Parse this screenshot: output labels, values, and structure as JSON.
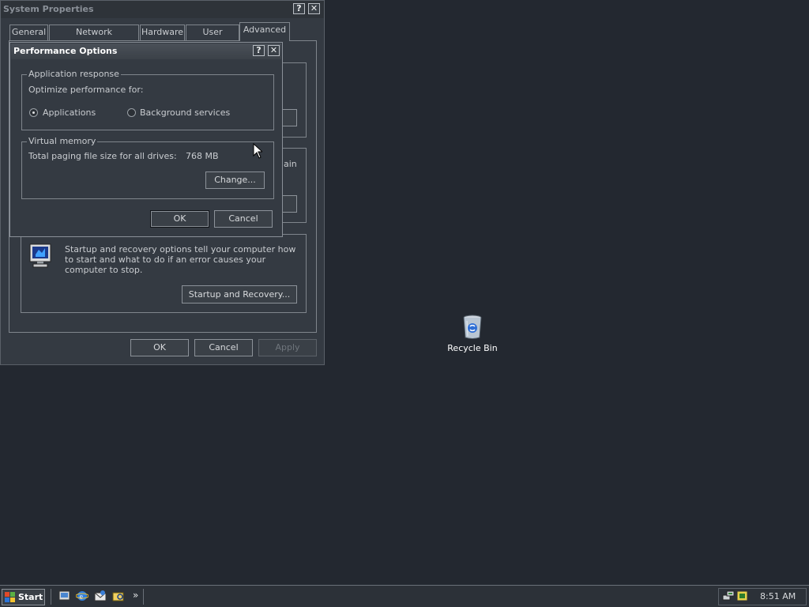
{
  "system_properties": {
    "title": "System Properties",
    "help_btn": "?",
    "close_btn": "✕",
    "tabs": [
      "General",
      "Network Identification",
      "Hardware",
      "User Profiles",
      "Advanced"
    ],
    "selected_tab": "Advanced",
    "partial_text_ain": "ain",
    "startup_text": "Startup and recovery options tell your computer how to start and what to do if an error causes your computer to stop.",
    "startup_button": "Startup and Recovery...",
    "ok": "OK",
    "cancel": "Cancel",
    "apply": "Apply"
  },
  "performance_options": {
    "title": "Performance Options",
    "help_btn": "?",
    "close_btn": "✕",
    "app_response_legend": "Application response",
    "optimize_label": "Optimize performance for:",
    "radio_applications": "Applications",
    "radio_background": "Background services",
    "selected": "Applications",
    "vm_legend": "Virtual memory",
    "paging_label": "Total paging file size for all drives:",
    "paging_value": "768 MB",
    "change_button": "Change...",
    "ok": "OK",
    "cancel": "Cancel"
  },
  "desktop": {
    "recycle_bin_label": "Recycle Bin"
  },
  "taskbar": {
    "start_label": "Start",
    "more_chevron": "»",
    "clock": "8:51 AM"
  },
  "colors": {
    "desktop": "#232830",
    "window_face": "#343a42",
    "taskbar": "#2c3138"
  }
}
